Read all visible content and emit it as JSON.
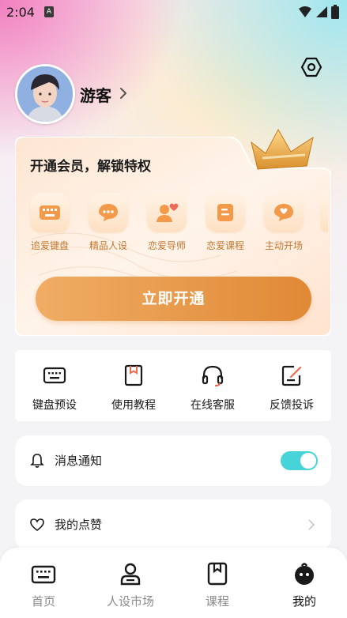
{
  "status_bar": {
    "time": "2:04",
    "app_badge": "A"
  },
  "profile": {
    "username": "游客"
  },
  "vip": {
    "title": "开通会员，解锁特权",
    "features": [
      {
        "label": "追爱键盘",
        "icon": "keyboard-icon"
      },
      {
        "label": "精品人设",
        "icon": "chat-bubble-icon"
      },
      {
        "label": "恋爱导师",
        "icon": "mentor-heart-icon"
      },
      {
        "label": "恋爱课程",
        "icon": "course-book-icon"
      },
      {
        "label": "主动开场",
        "icon": "heart-bubble-icon"
      }
    ],
    "button_label": "立即开通"
  },
  "tools": [
    {
      "label": "键盘预设",
      "icon": "keyboard-icon"
    },
    {
      "label": "使用教程",
      "icon": "bookmark-book-icon"
    },
    {
      "label": "在线客服",
      "icon": "headset-icon"
    },
    {
      "label": "反馈投诉",
      "icon": "edit-note-icon"
    }
  ],
  "settings": {
    "notifications": {
      "label": "消息通知",
      "enabled": true
    },
    "likes": {
      "label": "我的点赞"
    }
  },
  "tabbar": {
    "items": [
      {
        "label": "首页",
        "icon": "keyboard-icon"
      },
      {
        "label": "人设市场",
        "icon": "person-icon"
      },
      {
        "label": "课程",
        "icon": "bookmark-book-icon"
      },
      {
        "label": "我的",
        "icon": "mascot-icon"
      }
    ],
    "active_index": 3
  },
  "colors": {
    "accent_orange": "#e08936",
    "feature_label": "#c2782f",
    "toggle_on": "#46d4d8"
  }
}
